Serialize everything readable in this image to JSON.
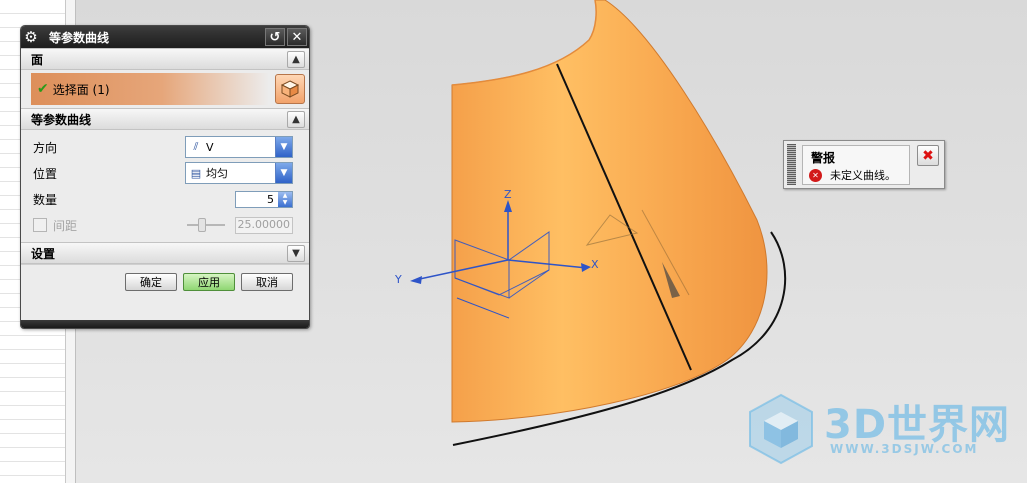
{
  "dialog": {
    "title": "等参数曲线",
    "face_section": {
      "header": "面",
      "select_label": "选择面 (1)"
    },
    "curve_section": {
      "header": "等参数曲线",
      "direction_label": "方向",
      "direction_value": "V",
      "position_label": "位置",
      "position_value": "均匀",
      "count_label": "数量",
      "count_value": "5",
      "spacing_label": "间距",
      "spacing_value": "25.00000"
    },
    "settings_section": {
      "header": "设置"
    },
    "buttons": {
      "ok": "确定",
      "apply": "应用",
      "cancel": "取消"
    }
  },
  "alert": {
    "title": "警报",
    "message": "未定义曲线。"
  },
  "viewport": {
    "axis_x": "X",
    "axis_y": "Y",
    "axis_z": "Z",
    "cone_color": "#f7a54a"
  },
  "watermark": {
    "brand": "3D世界网",
    "url": "WWW.3DSJW.COM"
  },
  "icons": [
    "gear-icon",
    "reset-icon",
    "close-icon",
    "check-icon",
    "cube-icon",
    "chevron-up-icon",
    "chevron-down-icon",
    "error-icon"
  ]
}
